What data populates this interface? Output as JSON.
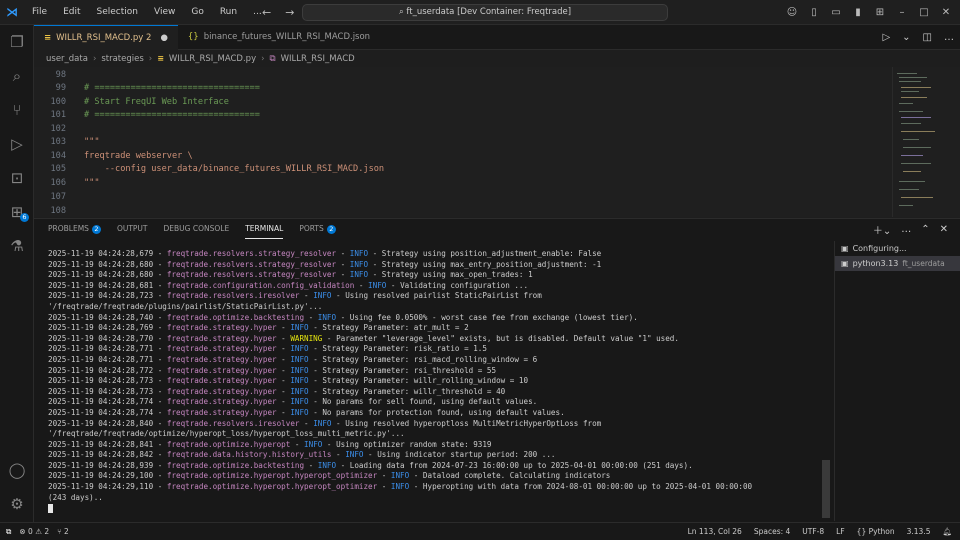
{
  "titlebar": {
    "menu": [
      "File",
      "Edit",
      "Selection",
      "View",
      "Go",
      "Run"
    ],
    "more": "...",
    "command_center": "ft_userdata [Dev Container: Freqtrade]"
  },
  "activity": {
    "extensions_badge": "6"
  },
  "tabs": [
    {
      "label": "WILLR_RSI_MACD.py 2",
      "icon": "py"
    },
    {
      "label": "binance_futures_WILLR_RSI_MACD.json",
      "icon": "{}"
    }
  ],
  "breadcrumbs": [
    "user_data",
    "strategies",
    "WILLR_RSI_MACD.py",
    "WILLR_RSI_MACD"
  ],
  "editor": {
    "lines": [
      {
        "n": "98",
        "t": "",
        "c": ""
      },
      {
        "n": "99",
        "t": "# ================================",
        "c": "cm"
      },
      {
        "n": "100",
        "t": "# Start FreqUI Web Interface",
        "c": "cm"
      },
      {
        "n": "101",
        "t": "# ================================",
        "c": "cm"
      },
      {
        "n": "102",
        "t": "",
        "c": ""
      },
      {
        "n": "103",
        "t": "\"\"\"",
        "c": "st"
      },
      {
        "n": "104",
        "t": "freqtrade webserver \\",
        "c": "st"
      },
      {
        "n": "105",
        "t": "    --config user_data/binance_futures_WILLR_RSI_MACD.json",
        "c": "st"
      },
      {
        "n": "106",
        "t": "\"\"\"",
        "c": "st"
      },
      {
        "n": "107",
        "t": "",
        "c": ""
      },
      {
        "n": "108",
        "t": "",
        "c": ""
      }
    ]
  },
  "panel": {
    "tabs": [
      {
        "label": "PROBLEMS",
        "badge": "2"
      },
      {
        "label": "OUTPUT",
        "badge": ""
      },
      {
        "label": "DEBUG CONSOLE",
        "badge": ""
      },
      {
        "label": "TERMINAL",
        "badge": ""
      },
      {
        "label": "PORTS",
        "badge": "2"
      }
    ],
    "terminal_lines": [
      {
        "ts": "2025-11-19 04:24:28,679",
        "mod": "freqtrade.resolvers.strategy_resolver",
        "lvl": "INFO",
        "msg": "Strategy using position_adjustment_enable: False"
      },
      {
        "ts": "2025-11-19 04:24:28,680",
        "mod": "freqtrade.resolvers.strategy_resolver",
        "lvl": "INFO",
        "msg": "Strategy using max_entry_position_adjustment: -1"
      },
      {
        "ts": "2025-11-19 04:24:28,680",
        "mod": "freqtrade.resolvers.strategy_resolver",
        "lvl": "INFO",
        "msg": "Strategy using max_open_trades: 1"
      },
      {
        "ts": "2025-11-19 04:24:28,681",
        "mod": "freqtrade.configuration.config_validation",
        "lvl": "INFO",
        "msg": "Validating configuration ..."
      },
      {
        "ts": "2025-11-19 04:24:28,723",
        "mod": "freqtrade.resolvers.iresolver",
        "lvl": "INFO",
        "msg": "Using resolved pairlist StaticPairList from"
      },
      {
        "ts": "",
        "mod": "",
        "lvl": "",
        "msg": "'/freqtrade/freqtrade/plugins/pairlist/StaticPairList.py'..."
      },
      {
        "ts": "2025-11-19 04:24:28,740",
        "mod": "freqtrade.optimize.backtesting",
        "lvl": "INFO",
        "msg": "Using fee 0.0500% - worst case fee from exchange (lowest tier)."
      },
      {
        "ts": "2025-11-19 04:24:28,769",
        "mod": "freqtrade.strategy.hyper",
        "lvl": "INFO",
        "msg": "Strategy Parameter: atr_mult = 2"
      },
      {
        "ts": "2025-11-19 04:24:28,770",
        "mod": "freqtrade.strategy.hyper",
        "lvl": "WARNING",
        "msg": "Parameter \"leverage_level\" exists, but is disabled. Default value \"1\" used."
      },
      {
        "ts": "2025-11-19 04:24:28,771",
        "mod": "freqtrade.strategy.hyper",
        "lvl": "INFO",
        "msg": "Strategy Parameter: risk_ratio = 1.5"
      },
      {
        "ts": "2025-11-19 04:24:28,771",
        "mod": "freqtrade.strategy.hyper",
        "lvl": "INFO",
        "msg": "Strategy Parameter: rsi_macd_rolling_window = 6"
      },
      {
        "ts": "2025-11-19 04:24:28,772",
        "mod": "freqtrade.strategy.hyper",
        "lvl": "INFO",
        "msg": "Strategy Parameter: rsi_threshold = 55"
      },
      {
        "ts": "2025-11-19 04:24:28,773",
        "mod": "freqtrade.strategy.hyper",
        "lvl": "INFO",
        "msg": "Strategy Parameter: willr_rolling_window = 10"
      },
      {
        "ts": "2025-11-19 04:24:28,773",
        "mod": "freqtrade.strategy.hyper",
        "lvl": "INFO",
        "msg": "Strategy Parameter: willr_threshold = 40"
      },
      {
        "ts": "2025-11-19 04:24:28,774",
        "mod": "freqtrade.strategy.hyper",
        "lvl": "INFO",
        "msg": "No params for sell found, using default values."
      },
      {
        "ts": "2025-11-19 04:24:28,774",
        "mod": "freqtrade.strategy.hyper",
        "lvl": "INFO",
        "msg": "No params for protection found, using default values."
      },
      {
        "ts": "2025-11-19 04:24:28,840",
        "mod": "freqtrade.resolvers.iresolver",
        "lvl": "INFO",
        "msg": "Using resolved hyperoptloss MultiMetricHyperOptLoss from"
      },
      {
        "ts": "",
        "mod": "",
        "lvl": "",
        "msg": "'/freqtrade/freqtrade/optimize/hyperopt_loss/hyperopt_loss_multi_metric.py'..."
      },
      {
        "ts": "2025-11-19 04:24:28,841",
        "mod": "freqtrade.optimize.hyperopt",
        "lvl": "INFO",
        "msg": "Using optimizer random state: 9319"
      },
      {
        "ts": "2025-11-19 04:24:28,842",
        "mod": "freqtrade.data.history.history_utils",
        "lvl": "INFO",
        "msg": "Using indicator startup period: 200 ..."
      },
      {
        "ts": "2025-11-19 04:24:28,939",
        "mod": "freqtrade.optimize.backtesting",
        "lvl": "INFO",
        "msg": "Loading data from 2024-07-23 16:00:00 up to 2025-04-01 00:00:00 (251 days)."
      },
      {
        "ts": "2025-11-19 04:24:29,100",
        "mod": "freqtrade.optimize.hyperopt.hyperopt_optimizer",
        "lvl": "INFO",
        "msg": "Dataload complete. Calculating indicators"
      },
      {
        "ts": "2025-11-19 04:24:29,110",
        "mod": "freqtrade.optimize.hyperopt.hyperopt_optimizer",
        "lvl": "INFO",
        "msg": "Hyperopting with data from 2024-08-01 00:00:00 up to 2025-04-01 00:00:00"
      },
      {
        "ts": "",
        "mod": "",
        "lvl": "",
        "msg": "(243 days).."
      }
    ],
    "terminal_list": [
      {
        "label": "Configuring...",
        "sub": ""
      },
      {
        "label": "python3.13",
        "sub": "ft_userdata"
      }
    ]
  },
  "statusbar": {
    "problems": "0",
    "warnings": "2",
    "ports": "2",
    "position": "Ln 113, Col 26",
    "spaces": "Spaces: 4",
    "encoding": "UTF-8",
    "eol": "LF",
    "language": "Python",
    "version": "3.13.5"
  },
  "colors": {
    "accent": "#0078d4",
    "module": "#c586c0",
    "info": "#3b8eea",
    "warning": "#e5e510",
    "comment": "#6a9955",
    "string": "#ce9178"
  }
}
